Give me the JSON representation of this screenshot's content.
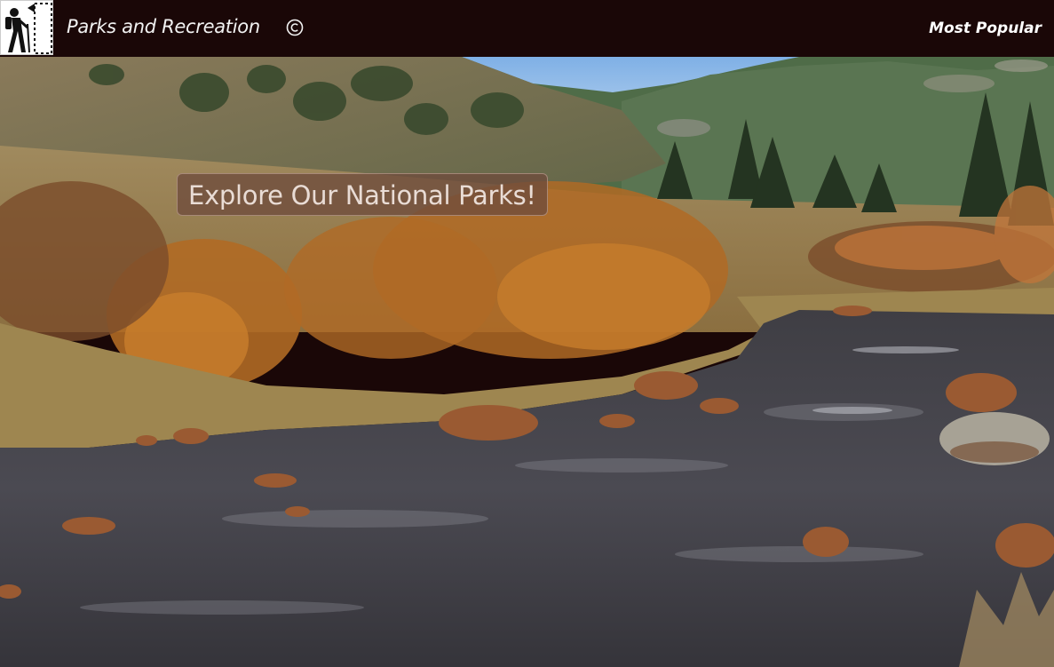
{
  "header": {
    "brand": "Parks and Recreation",
    "logo_icon": "hiker-icon",
    "copyright_icon": "copyright-icon",
    "nav_link": "Most Popular"
  },
  "hero": {
    "title": "Explore Our National Parks!",
    "background_image": "river-landscape"
  },
  "colors": {
    "navbar": "#1a0707",
    "nav_text": "#ffffff"
  }
}
